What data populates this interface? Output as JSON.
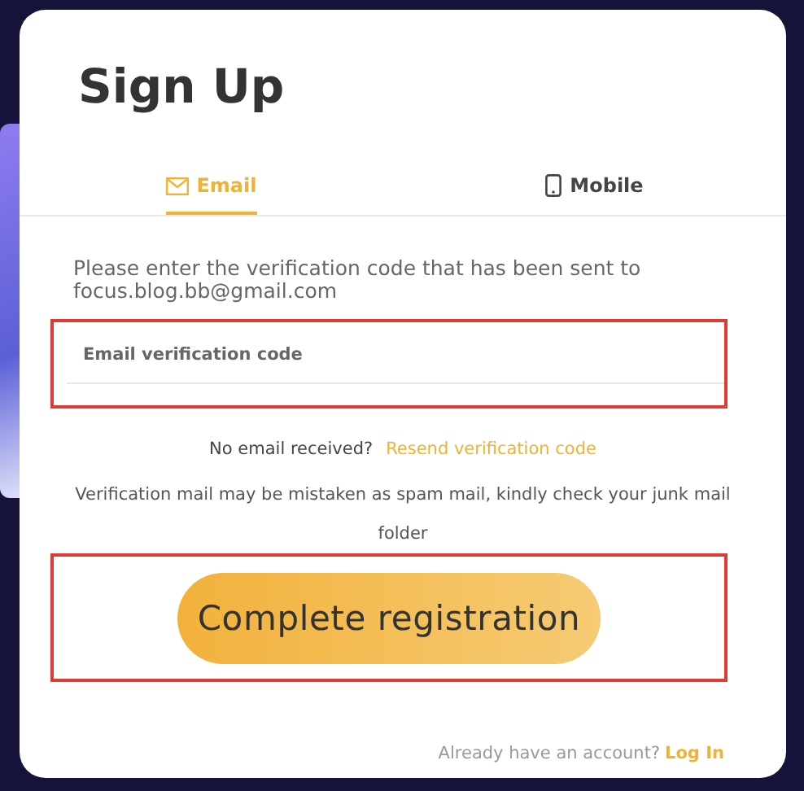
{
  "title": "Sign Up",
  "tabs": [
    {
      "label": "Email",
      "selected": true
    },
    {
      "label": "Mobile",
      "selected": false
    }
  ],
  "instruction": "Please enter the verification code that has been sent to focus.blog.bb@gmail.com",
  "code_field": {
    "placeholder": "Email verification code",
    "highlighted": true
  },
  "resend": {
    "text": "No email received?",
    "link": "Resend verification code"
  },
  "notice": "Verification mail may be mistaken as spam mail, kindly check your junk mail folder",
  "submit": {
    "label": "Complete registration",
    "highlighted": true
  },
  "footer": {
    "text": "Already have an account?",
    "link": "Log In"
  }
}
